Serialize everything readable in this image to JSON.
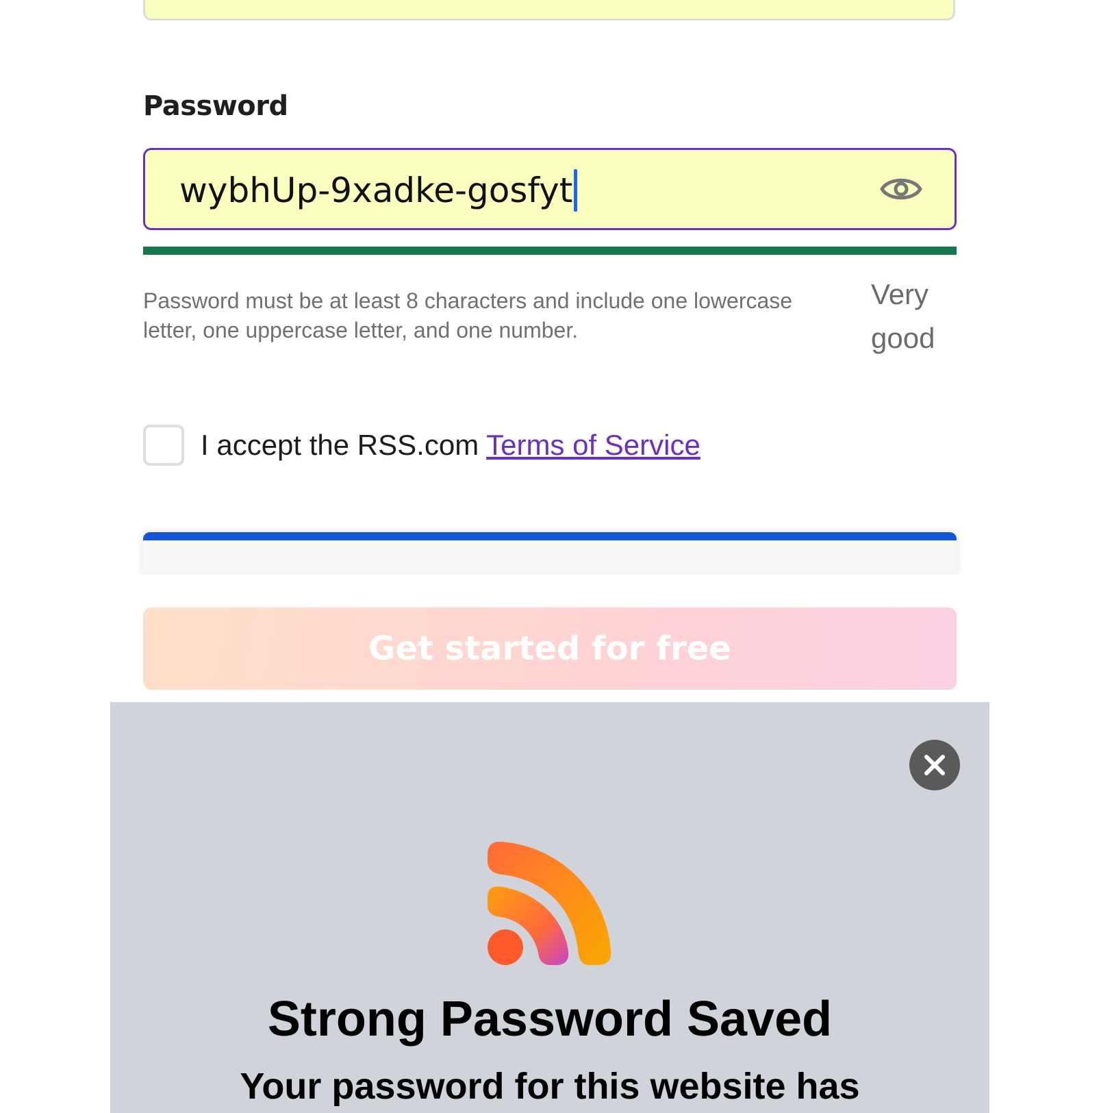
{
  "form": {
    "password_label": "Password",
    "password_value": "wybhUp-9xadke-gosfyt",
    "strength": {
      "fraction": 1.0,
      "color": "#17784f",
      "rating": "Very good"
    },
    "hint": "Password must be at least 8 characters and include one lowercase letter, one uppercase letter, and one number.",
    "terms_prefix": "I accept the RSS.com ",
    "terms_link": "Terms of Service",
    "terms_checked": false,
    "submit_label": "Get started for free"
  },
  "sheet": {
    "title": "Strong Password Saved",
    "subtitle": "Your password for this website has"
  },
  "icons": {
    "show_password": "eye-icon",
    "close": "close-icon",
    "logo": "rss-logo-icon"
  },
  "colors": {
    "field_bg": "#f9ffbd",
    "focus_border": "#6a2fc7",
    "link": "#6a2fc7",
    "captcha_accent": "#1456d6",
    "sheet_bg": "#d1d3da"
  }
}
